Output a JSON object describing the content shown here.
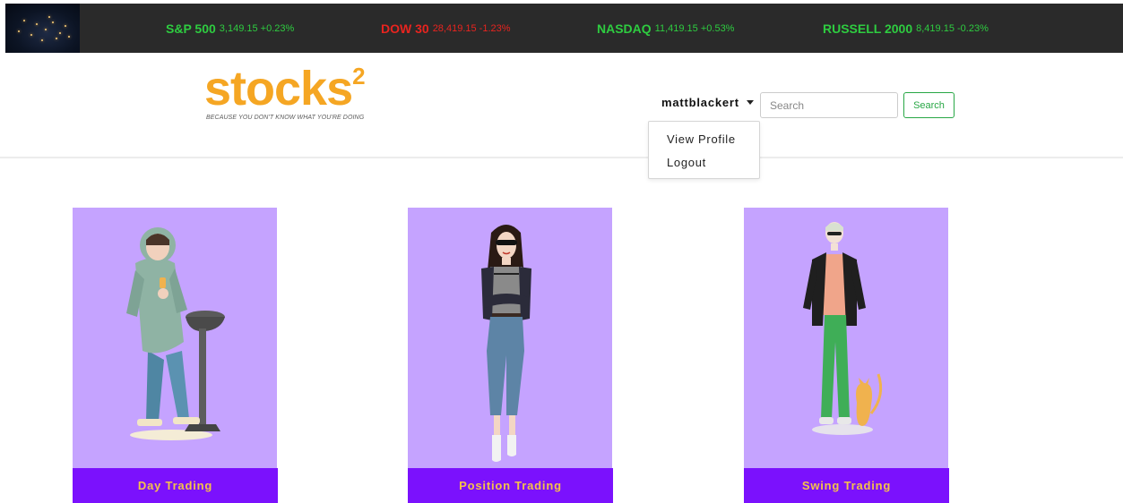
{
  "ticker": [
    {
      "name": "S&P 500",
      "values": "3,149.15 +0.23%",
      "status": "up"
    },
    {
      "name": "DOW 30",
      "values": "28,419.15 -1.23%",
      "status": "down"
    },
    {
      "name": "NASDAQ",
      "values": "11,419.15 +0.53%",
      "status": "up"
    },
    {
      "name": "RUSSELL 2000",
      "values": "8,419.15 -0.23%",
      "status": "up"
    }
  ],
  "logo": {
    "word": "stocks",
    "superscript": "2",
    "tagline": "BECAUSE YOU DON'T KNOW WHAT YOU'RE DOING"
  },
  "header": {
    "username": "mattblackert",
    "search_placeholder": "Search",
    "search_button": "Search"
  },
  "dropdown": {
    "items": [
      "View Profile",
      "Logout"
    ]
  },
  "cards": [
    {
      "label": "Day Trading"
    },
    {
      "label": "Position Trading"
    },
    {
      "label": "Swing Trading"
    }
  ],
  "colors": {
    "ticker_bg": "#2a2a2a",
    "up": "#2ecc40",
    "down": "#e8241f",
    "logo": "#f5a623",
    "card_bg": "#c5a3ff",
    "card_footer": "#7b11fd",
    "card_footer_text": "#f5c24a",
    "search_button": "#28a745"
  }
}
